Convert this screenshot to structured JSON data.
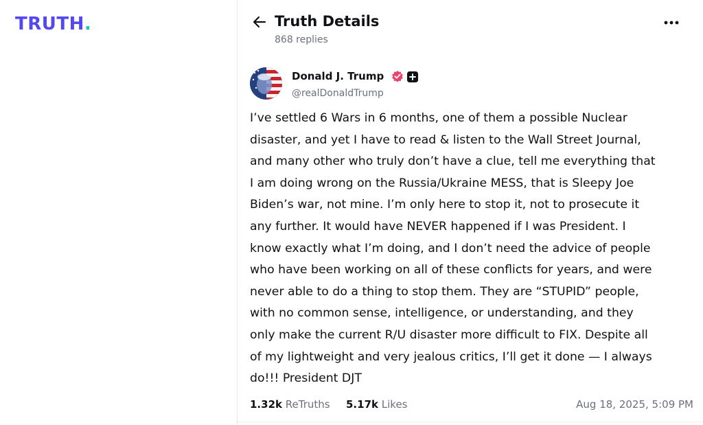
{
  "sidebar": {
    "logo_text": "TRUTH",
    "logo_dot": ".",
    "logo_color": "#5448ee",
    "logo_dot_color": "#1ec8a5"
  },
  "header": {
    "back_icon": "arrow-left-icon",
    "title": "Truth Details",
    "replies": "868 replies",
    "more_icon": "more-horizontal-icon"
  },
  "post": {
    "author_name": "Donald J. Trump",
    "handle": "@realDonaldTrump",
    "verified_icon": "verified-badge-icon",
    "verified_color": "#e8446f",
    "plus_icon": "plus-badge-icon",
    "text": "I’ve settled 6 Wars in 6 months, one of them a possible Nuclear\ndisaster, and yet I have to read & listen to the Wall Street Journal,\nand many other who truly don’t have a clue, tell me everything that\nI am doing wrong on the Russia/Ukraine MESS, that is Sleepy Joe\nBiden’s war, not mine. I’m only here to stop it, not to prosecute it\nany further. It would have NEVER happened if I was President. I\nknow exactly what I’m doing, and I don’t need the advice of people\nwho have been working on all of these conflicts for years, and were\nnever able to do a thing to stop them. They are “STUPID” people,\nwith no common sense, intelligence, or understanding, and they\nonly make the current R/U disaster more difficult to FIX. Despite all\nof my lightweight and very jealous critics, I’ll get it done — I always\ndo!!! President DJT",
    "retruths_count": "1.32k",
    "retruths_label": "ReTruths",
    "likes_count": "5.17k",
    "likes_label": "Likes",
    "timestamp": "Aug 18, 2025, 5:09 PM"
  }
}
